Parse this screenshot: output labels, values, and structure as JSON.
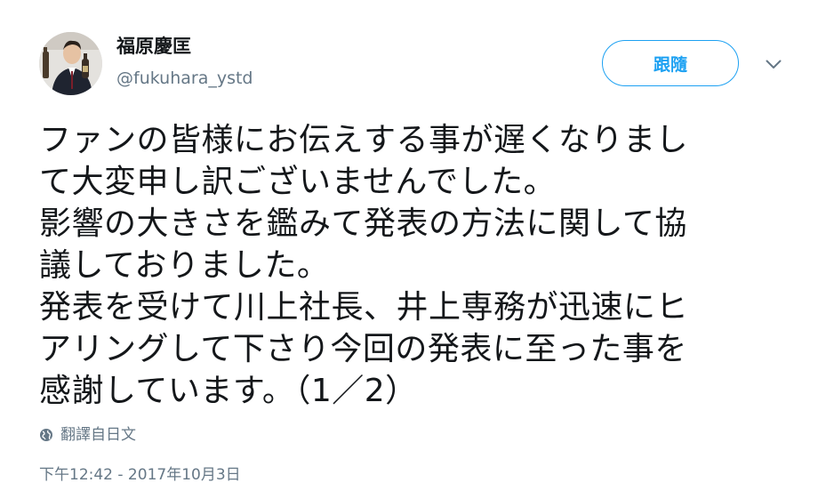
{
  "user": {
    "display_name": "福原慶匡",
    "handle": "@fukuhara_ystd"
  },
  "follow_button": {
    "label": "跟隨"
  },
  "icons": {
    "menu": "chevron-down-icon",
    "translate": "globe-icon"
  },
  "tweet": {
    "lines": [
      "ファンの皆様にお伝えする事が遅くなりまし",
      "て大変申し訳ございませんでした。",
      "影響の大きさを鑑みて発表の方法に関して協",
      "議しておりました。",
      "発表を受けて川上社長、井上専務が迅速にヒ",
      "アリングして下さり今回の発表に至った事を",
      "感謝しています。（1／2）"
    ]
  },
  "translate": {
    "label": "翻譯自日文"
  },
  "timestamp": "下午12:42 - 2017年10月3日",
  "colors": {
    "accent": "#1da1f2",
    "text": "#14171a",
    "muted": "#657786"
  }
}
